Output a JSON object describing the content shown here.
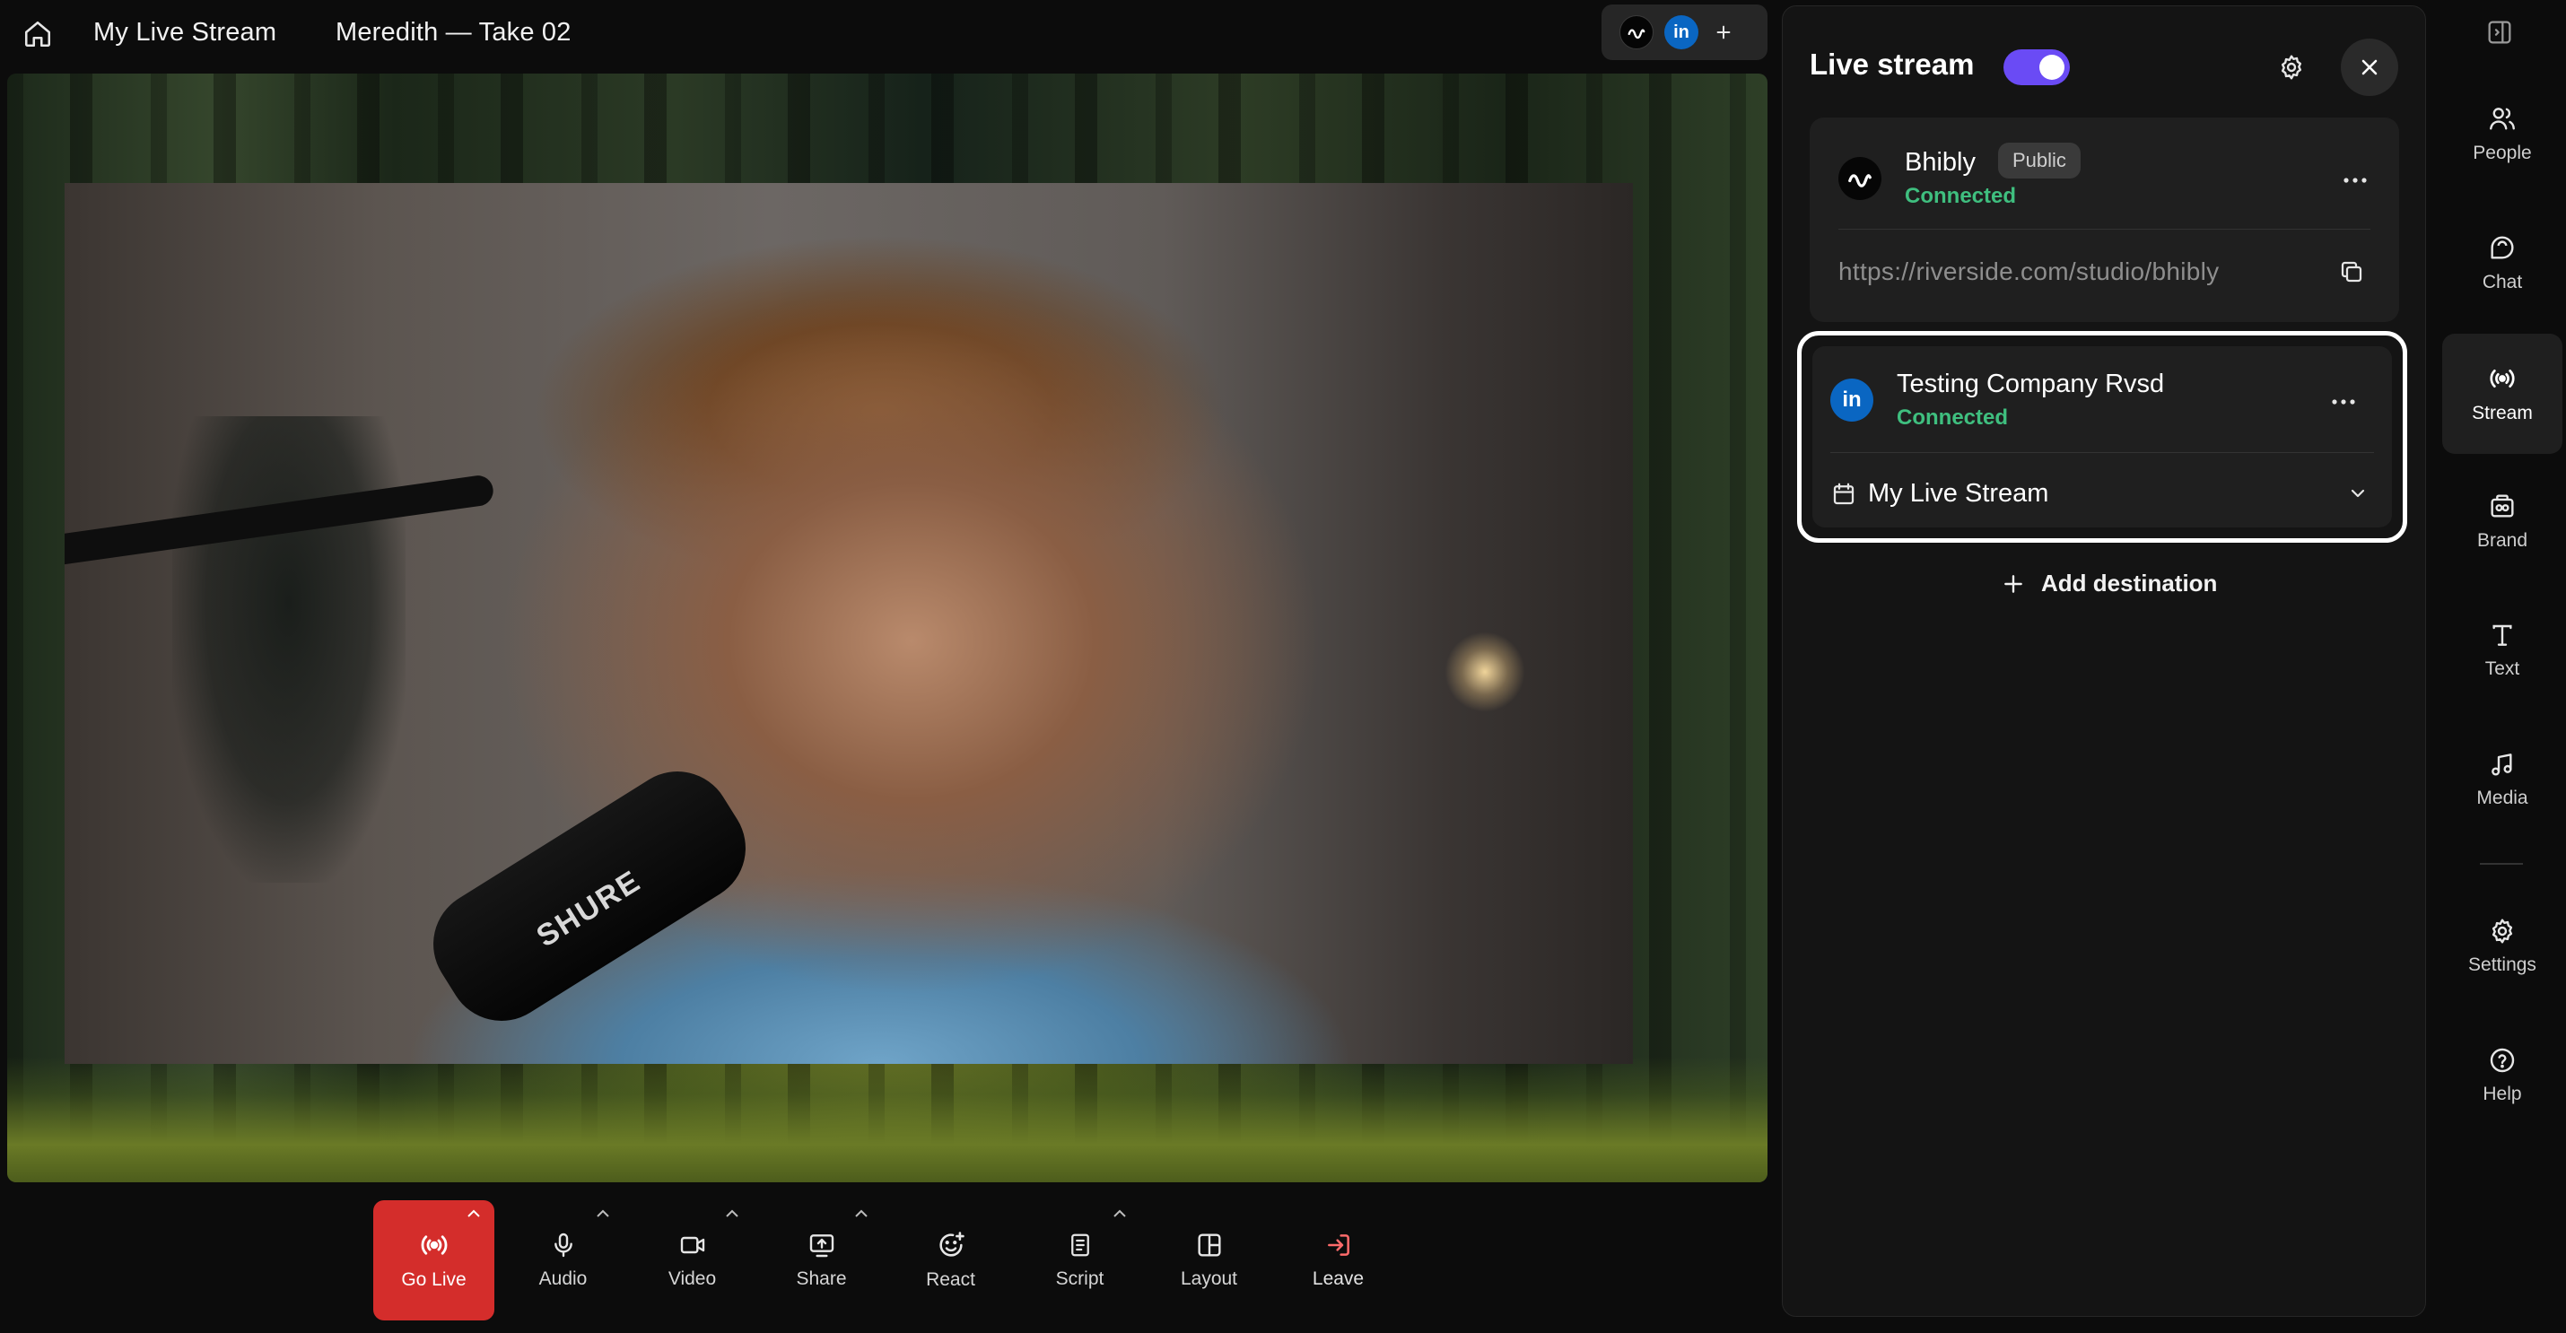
{
  "topbar": {
    "project_title": "My Live Stream",
    "take_title": "Meredith — Take 02",
    "destinations_pill": {
      "icons": [
        "bhibly-logo-icon",
        "linkedin-icon",
        "plus-icon"
      ],
      "linkedin_text": "in",
      "add_symbol": "+"
    }
  },
  "stage": {
    "description_free": true
  },
  "controls": {
    "items": [
      {
        "label": "Go Live",
        "icon": "broadcast-icon",
        "has_caret": true
      },
      {
        "label": "Audio",
        "icon": "microphone-icon",
        "has_caret": true
      },
      {
        "label": "Video",
        "icon": "camera-icon",
        "has_caret": true
      },
      {
        "label": "Share",
        "icon": "screen-share-icon",
        "has_caret": true
      },
      {
        "label": "React",
        "icon": "emoji-add-icon",
        "has_caret": false
      },
      {
        "label": "Script",
        "icon": "script-icon",
        "has_caret": true
      },
      {
        "label": "Layout",
        "icon": "layout-icon",
        "has_caret": false
      },
      {
        "label": "Leave",
        "icon": "leave-icon",
        "has_caret": false
      }
    ]
  },
  "panel": {
    "title": "Live stream",
    "toggle_on": true,
    "destinations": [
      {
        "name": "Bhibly",
        "badge": "Public",
        "status": "Connected",
        "url": "https://riverside.com/studio/bhibly",
        "icon": "bhibly-logo-icon"
      },
      {
        "name": "Testing Company Rvsd",
        "status": "Connected",
        "avatar_text": "in",
        "stream_select": "My Live Stream",
        "icon": "linkedin-icon"
      }
    ],
    "add_destination": "Add destination"
  },
  "rail": {
    "items": [
      {
        "label": "People",
        "icon": "people-icon"
      },
      {
        "label": "Chat",
        "icon": "chat-icon"
      },
      {
        "label": "Stream",
        "icon": "stream-icon",
        "active": true
      },
      {
        "label": "Brand",
        "icon": "brand-icon"
      },
      {
        "label": "Text",
        "icon": "text-icon"
      },
      {
        "label": "Media",
        "icon": "music-note-icon"
      },
      {
        "label": "Settings",
        "icon": "gear-icon"
      },
      {
        "label": "Help",
        "icon": "help-icon"
      }
    ]
  },
  "colors": {
    "background": "#0c0c0c",
    "panel": "#141414",
    "card": "#1f1f1f",
    "accent_toggle": "#6a4bf5",
    "go_live": "#d42d2b",
    "connected": "#3fbf7f",
    "linkedin": "#0a66c2",
    "leave_icon": "#ff6b6b"
  }
}
